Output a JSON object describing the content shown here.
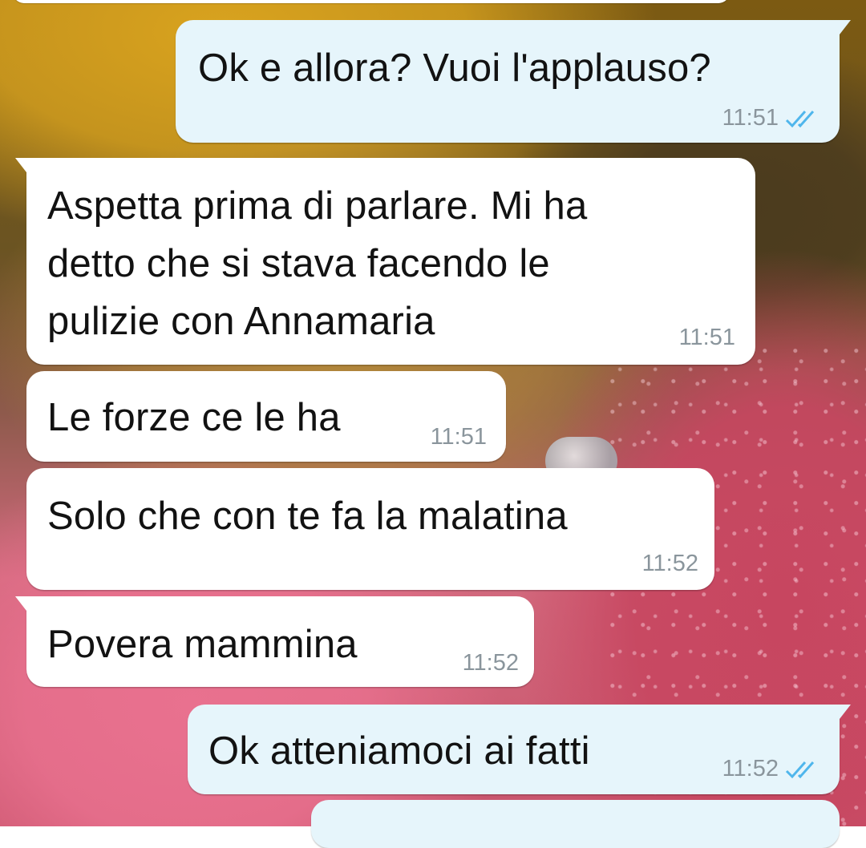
{
  "chat": {
    "messages": [
      {
        "id": "m1",
        "direction": "out",
        "text": "Ok e allora? Vuoi l'applauso?",
        "time": "11:51",
        "status": "read"
      },
      {
        "id": "m2",
        "direction": "in",
        "text": "Aspetta prima di parlare. Mi ha\ndetto che si stava facendo le\npulizie con Annamaria",
        "time": "11:51"
      },
      {
        "id": "m3",
        "direction": "in",
        "text": "Le forze ce le ha",
        "time": "11:51"
      },
      {
        "id": "m4",
        "direction": "in",
        "text": "Solo che con te fa la malatina",
        "time": "11:52"
      },
      {
        "id": "m5",
        "direction": "in",
        "text": "Povera mammina",
        "time": "11:52"
      },
      {
        "id": "m6",
        "direction": "out",
        "text": "Ok atteniamoci ai fatti",
        "time": "11:52",
        "status": "read"
      }
    ]
  },
  "colors": {
    "incoming_bubble": "#ffffff",
    "outgoing_bubble": "#e6f5fb",
    "read_ticks": "#4fb6ec",
    "timestamp": "#8a959c"
  },
  "icons": {
    "read_receipt": "double-check-icon"
  }
}
